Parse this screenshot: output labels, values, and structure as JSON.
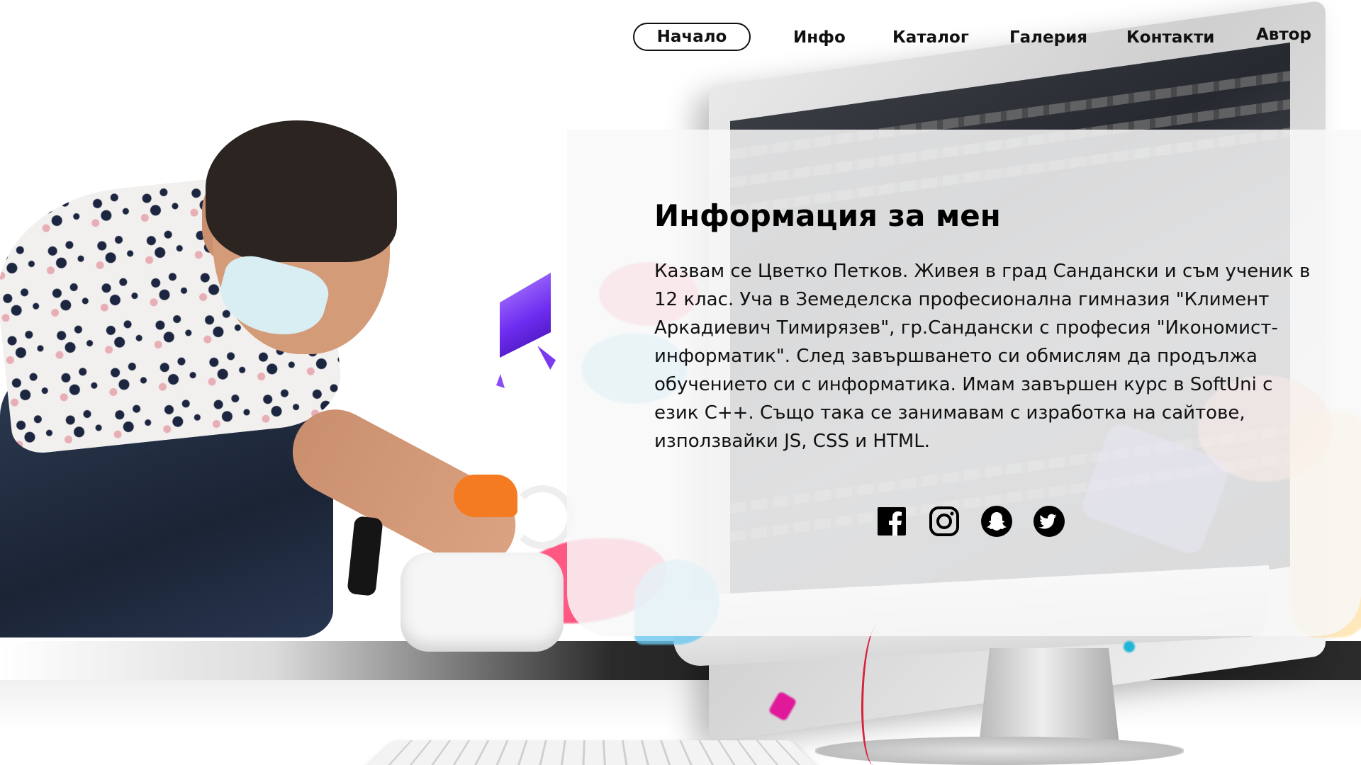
{
  "nav": {
    "items": [
      {
        "label": "Начало",
        "active": true
      },
      {
        "label": "Инфо"
      },
      {
        "label": "Каталог"
      },
      {
        "label": "Галерия"
      },
      {
        "label": "Контакти"
      },
      {
        "label": "Автор"
      }
    ]
  },
  "about": {
    "title": "Информация за мен",
    "text": "Казвам се Цветко Петков. Живея в град Сандански и съм ученик в 12 клас. Уча в Земеделска професионална гимназия \"Климент Аркадиевич Тимирязев\", гр.Сандански с професия \"Икономист-информатик\". След завършването си обмислям да продължа обучението си с информатика. Имам завършен курс в SoftUni с език C++. Също така се занимавам с изработка на сайтове, използвайки JS, CSS и HTML."
  },
  "social": [
    {
      "icon": "facebook-icon"
    },
    {
      "icon": "instagram-icon"
    },
    {
      "icon": "snapchat-icon"
    },
    {
      "icon": "twitter-icon"
    }
  ],
  "colors": {
    "accent": "#111111",
    "card_background": "#f8f8f8",
    "crystal": "#6e2cf0"
  }
}
